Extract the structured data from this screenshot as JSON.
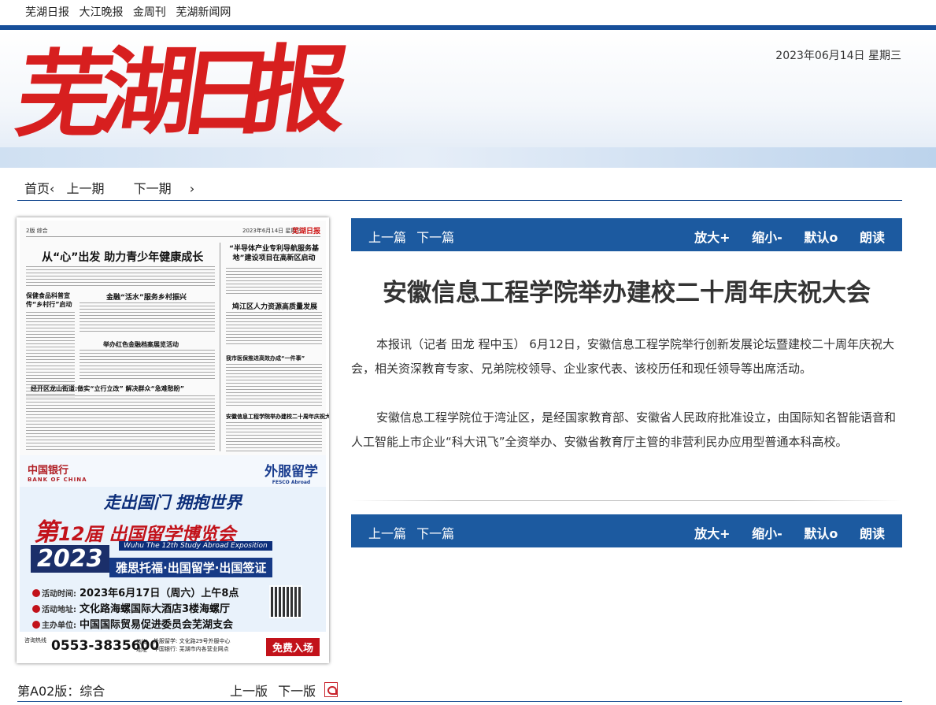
{
  "top_links": [
    "芜湖日报",
    "大江晚报",
    "金周刊",
    "芜湖新闻网"
  ],
  "header": {
    "logo_text": [
      "芜",
      "湖",
      "日",
      "报"
    ],
    "date": "2023年06月14日  星期三"
  },
  "nav": {
    "home": "首页‹",
    "prev_issue": "上一期",
    "next_issue": "下一期",
    "next_arrow": "›"
  },
  "newspaper_page": {
    "header_left": "2版  综合",
    "header_date": "2023年6月14日  星期三",
    "brand": "芜湖日报",
    "headlines": [
      "从“心”出发  助力青少年健康成长",
      "“半导体产业专利导航服务基地”建设项目在高新区启动",
      "保健食品科普宣传“乡村行”启动",
      "金融“活水”服务乡村振兴",
      "鸠江区人力资源高质量发展",
      "举办红色金融档案展览活动",
      "我市医保推进高效办成“一件事”",
      "经开区龙山街道:做实“立行立改” 解决群众“急难愁盼”",
      "安徽信息工程学院举办建校二十周年庆祝大会"
    ],
    "ad": {
      "bank_cn": "中国银行",
      "bank_en": "BANK OF CHINA",
      "fesco_cn": "外服留学",
      "fesco_en": "FESCO Abroad",
      "slogan": "走出国门  拥抱世界",
      "main_prefix": "第",
      "main_num": "12",
      "main_suffix": "届 出国留学博览会",
      "english": "Wuhu The 12th Study Abroad Exposition",
      "year": "2023",
      "sub": "雅思托福·出国留学·出国签证",
      "time_tag": "活动时间:",
      "time": "2023年6月17日（周六）上午8点",
      "place_tag": "活动地址:",
      "place": "文化路海螺国际大酒店3楼海螺厅",
      "host_tag": "主办单位:",
      "host": "中国国际贸易促进委员会芜湖支会",
      "hotline_tag": "咨询热线",
      "phone": "0553-3835600",
      "addr_tag": "咨询地址",
      "addr1": "外服留学: 文化路29号外服中心",
      "addr2": "中国银行: 芜湖市内各营业网点",
      "free": "免费入场"
    }
  },
  "edition": {
    "label": "第A02版：综合",
    "prev": "上一版",
    "next": "下一版"
  },
  "toolbar": {
    "prev_article": "上一篇",
    "next_article": "下一篇",
    "zoom_in": "放大+",
    "zoom_out": "缩小-",
    "default": "默认o",
    "read": "朗读"
  },
  "article": {
    "title": "安徽信息工程学院举办建校二十周年庆祝大会",
    "paragraphs": [
      "本报讯（记者  田龙  程中玉）  6月12日，安徽信息工程学院举行创新发展论坛暨建校二十周年庆祝大会，相关资深教育专家、兄弟院校领导、企业家代表、该校历任和现任领导等出席活动。",
      "安徽信息工程学院位于湾沚区，是经国家教育部、安徽省人民政府批准设立，由国际知名智能语音和人工智能上市企业“科大讯飞”全资举办、安徽省教育厅主管的非营利民办应用型普通本科高校。"
    ]
  },
  "colors": {
    "accent": "#1c5aa0",
    "logo_red": "#d71f1f"
  }
}
